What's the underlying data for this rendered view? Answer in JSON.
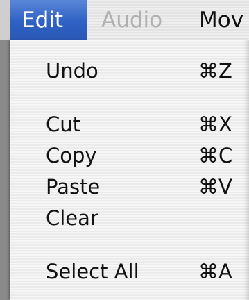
{
  "menubar": {
    "items": [
      {
        "label": "Edit",
        "state": "active"
      },
      {
        "label": "Audio",
        "state": "disabled"
      },
      {
        "label": "Mov",
        "state": "normal"
      }
    ]
  },
  "edit_menu": {
    "items": [
      {
        "label": "Undo",
        "shortcut": "⌘Z"
      },
      {
        "label": "Cut",
        "shortcut": "⌘X"
      },
      {
        "label": "Copy",
        "shortcut": "⌘C"
      },
      {
        "label": "Paste",
        "shortcut": "⌘V"
      },
      {
        "label": "Clear",
        "shortcut": ""
      },
      {
        "label": "Select All",
        "shortcut": "⌘A"
      }
    ]
  },
  "colors": {
    "highlight": "#2f62c4",
    "menu_text": "#111111",
    "disabled_text": "#b0b0b0"
  }
}
